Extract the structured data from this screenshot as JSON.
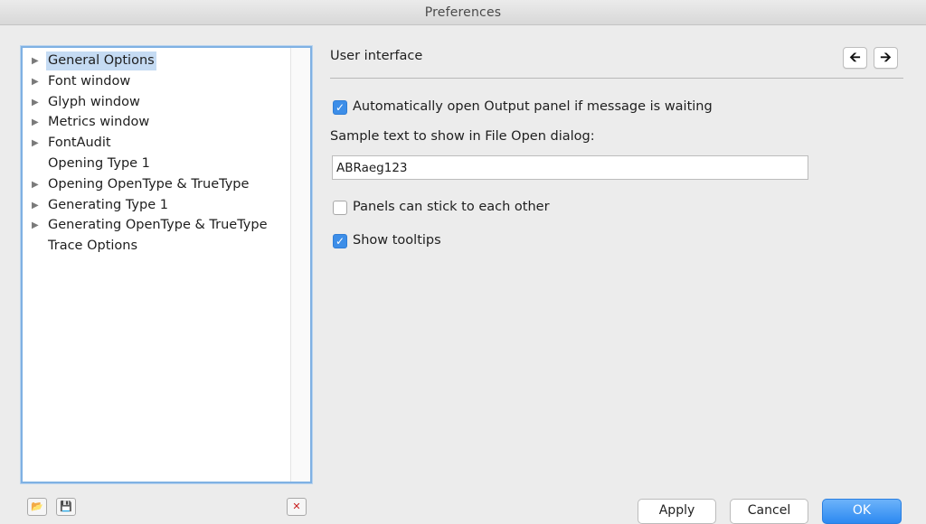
{
  "window": {
    "title": "Preferences"
  },
  "tree": {
    "items": [
      {
        "label": "General Options",
        "expandable": true,
        "selected": true
      },
      {
        "label": "Font window",
        "expandable": true,
        "selected": false
      },
      {
        "label": "Glyph window",
        "expandable": true,
        "selected": false
      },
      {
        "label": "Metrics window",
        "expandable": true,
        "selected": false
      },
      {
        "label": "FontAudit",
        "expandable": true,
        "selected": false
      },
      {
        "label": "Opening Type 1",
        "expandable": false,
        "selected": false
      },
      {
        "label": "Opening OpenType & TrueType",
        "expandable": true,
        "selected": false
      },
      {
        "label": "Generating Type 1",
        "expandable": true,
        "selected": false
      },
      {
        "label": "Generating OpenType & TrueType",
        "expandable": true,
        "selected": false
      },
      {
        "label": "Trace Options",
        "expandable": false,
        "selected": false
      }
    ]
  },
  "section": {
    "title": "User interface",
    "nav_back_icon": "arrow-left-icon",
    "nav_forward_icon": "arrow-right-icon"
  },
  "options": {
    "auto_open_output": {
      "label": "Automatically open Output panel if message is waiting",
      "checked": true
    },
    "sample_text": {
      "label": "Sample text to show in File Open dialog:",
      "value": "ABRaeg123"
    },
    "panels_stick": {
      "label": "Panels can stick to each other",
      "checked": false
    },
    "show_tooltips": {
      "label": "Show tooltips",
      "checked": true
    }
  },
  "footer": {
    "apply_label": "Apply",
    "cancel_label": "Cancel",
    "ok_label": "OK"
  },
  "colors": {
    "accent": "#3d8ee8",
    "selection": "#c5dbf3",
    "focus_ring": "#7fb1e3"
  }
}
